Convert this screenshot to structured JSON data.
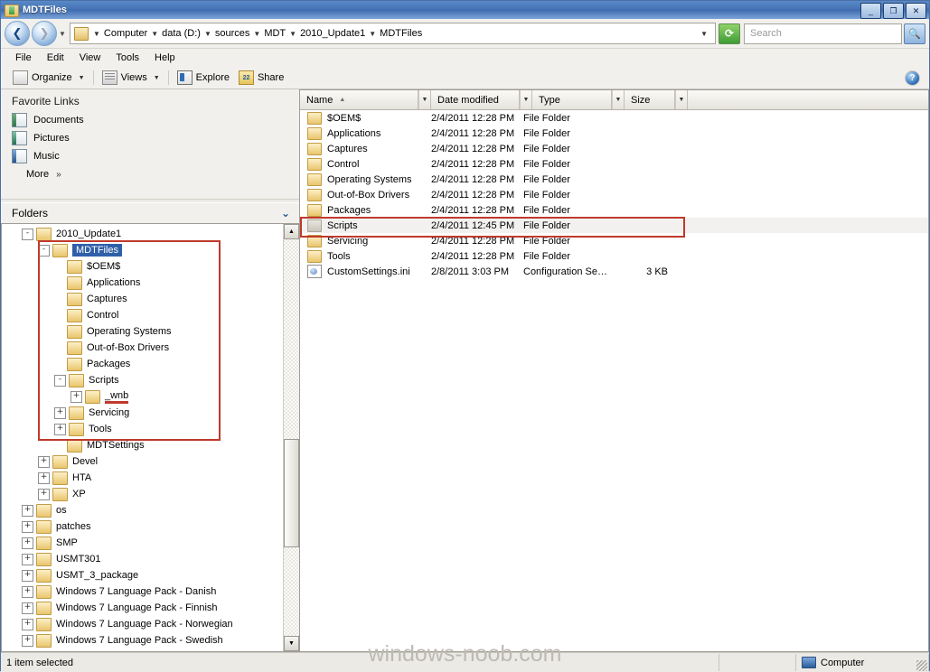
{
  "window": {
    "title": "MDTFiles",
    "icon": "folder-green-icon",
    "controls": {
      "minimize": "_",
      "maximize": "❐",
      "close": "✕"
    }
  },
  "address": {
    "back_icon": "back-arrow-icon",
    "forward_icon": "forward-arrow-icon",
    "history_icon": "chevron-down-icon",
    "folder_icon": "folder-icon",
    "breadcrumbs": [
      "Computer",
      "data (D:)",
      "sources",
      "MDT",
      "2010_Update1",
      "MDTFiles"
    ],
    "refresh_icon": "refresh-icon",
    "search": {
      "placeholder": "Search",
      "value": ""
    },
    "search_button_icon": "magnifier-icon"
  },
  "menu": {
    "items": [
      "File",
      "Edit",
      "View",
      "Tools",
      "Help"
    ]
  },
  "toolbar": {
    "organize": "Organize",
    "views": "Views",
    "explore": "Explore",
    "share": "Share",
    "help_icon": "help-icon"
  },
  "favorites": {
    "title": "Favorite Links",
    "items": [
      {
        "label": "Documents",
        "icon": "documents-icon"
      },
      {
        "label": "Pictures",
        "icon": "pictures-icon"
      },
      {
        "label": "Music",
        "icon": "music-icon"
      }
    ],
    "more": "More",
    "more_icon": "double-chevron-right-icon"
  },
  "folders_panel": {
    "title": "Folders",
    "collapse_icon": "chevron-down-icon",
    "tree": [
      {
        "label": "2010_Update1",
        "indent": 1,
        "expander": "-",
        "icon": "folder-icon",
        "selected": false
      },
      {
        "label": "MDTFiles",
        "indent": 2,
        "expander": "-",
        "icon": "folder-icon",
        "selected": true
      },
      {
        "label": "$OEM$",
        "indent": 3,
        "expander": "",
        "icon": "folder-icon",
        "selected": false
      },
      {
        "label": "Applications",
        "indent": 3,
        "expander": "",
        "icon": "folder-icon",
        "selected": false
      },
      {
        "label": "Captures",
        "indent": 3,
        "expander": "",
        "icon": "folder-icon",
        "selected": false
      },
      {
        "label": "Control",
        "indent": 3,
        "expander": "",
        "icon": "folder-icon",
        "selected": false
      },
      {
        "label": "Operating Systems",
        "indent": 3,
        "expander": "",
        "icon": "folder-icon",
        "selected": false
      },
      {
        "label": "Out-of-Box Drivers",
        "indent": 3,
        "expander": "",
        "icon": "folder-icon",
        "selected": false
      },
      {
        "label": "Packages",
        "indent": 3,
        "expander": "",
        "icon": "folder-icon",
        "selected": false
      },
      {
        "label": "Scripts",
        "indent": 3,
        "expander": "-",
        "icon": "folder-icon",
        "selected": false
      },
      {
        "label": "_wnb",
        "indent": 4,
        "expander": "+",
        "icon": "folder-icon",
        "selected": false,
        "underline": true
      },
      {
        "label": "Servicing",
        "indent": 3,
        "expander": "+",
        "icon": "folder-icon",
        "selected": false
      },
      {
        "label": "Tools",
        "indent": 3,
        "expander": "+",
        "icon": "folder-icon",
        "selected": false
      },
      {
        "label": "MDTSettings",
        "indent": 3,
        "expander": "",
        "icon": "folder-icon",
        "selected": false
      },
      {
        "label": "Devel",
        "indent": 2,
        "expander": "+",
        "icon": "folder-icon",
        "selected": false
      },
      {
        "label": "HTA",
        "indent": 2,
        "expander": "+",
        "icon": "folder-icon",
        "selected": false
      },
      {
        "label": "XP",
        "indent": 2,
        "expander": "+",
        "icon": "folder-icon",
        "selected": false
      },
      {
        "label": "os",
        "indent": 1,
        "expander": "+",
        "icon": "folder-icon",
        "selected": false
      },
      {
        "label": "patches",
        "indent": 1,
        "expander": "+",
        "icon": "folder-icon",
        "selected": false
      },
      {
        "label": "SMP",
        "indent": 1,
        "expander": "+",
        "icon": "folder-icon",
        "selected": false
      },
      {
        "label": "USMT301",
        "indent": 1,
        "expander": "+",
        "icon": "folder-icon",
        "selected": false
      },
      {
        "label": "USMT_3_package",
        "indent": 1,
        "expander": "+",
        "icon": "folder-icon",
        "selected": false
      },
      {
        "label": "Windows 7 Language Pack - Danish",
        "indent": 1,
        "expander": "+",
        "icon": "folder-icon",
        "selected": false
      },
      {
        "label": "Windows 7 Language Pack - Finnish",
        "indent": 1,
        "expander": "+",
        "icon": "folder-icon",
        "selected": false
      },
      {
        "label": "Windows 7 Language Pack - Norwegian",
        "indent": 1,
        "expander": "+",
        "icon": "folder-icon",
        "selected": false
      },
      {
        "label": "Windows 7 Language Pack - Swedish",
        "indent": 1,
        "expander": "+",
        "icon": "folder-icon",
        "selected": false
      }
    ],
    "scroll_up_icon": "scroll-up-arrow-icon",
    "scroll_down_icon": "scroll-down-arrow-icon"
  },
  "filelist": {
    "columns": [
      {
        "label": "Name",
        "sorted": "asc"
      },
      {
        "label": "Date modified",
        "sorted": ""
      },
      {
        "label": "Type",
        "sorted": ""
      },
      {
        "label": "Size",
        "sorted": ""
      }
    ],
    "sort_arrow_icon": "sort-ascending-icon",
    "rows": [
      {
        "name": "$OEM$",
        "date": "2/4/2011 12:28 PM",
        "type": "File Folder",
        "size": "",
        "icon": "folder-icon",
        "selected": false
      },
      {
        "name": "Applications",
        "date": "2/4/2011 12:28 PM",
        "type": "File Folder",
        "size": "",
        "icon": "folder-icon",
        "selected": false
      },
      {
        "name": "Captures",
        "date": "2/4/2011 12:28 PM",
        "type": "File Folder",
        "size": "",
        "icon": "folder-icon",
        "selected": false
      },
      {
        "name": "Control",
        "date": "2/4/2011 12:28 PM",
        "type": "File Folder",
        "size": "",
        "icon": "folder-icon",
        "selected": false
      },
      {
        "name": "Operating Systems",
        "date": "2/4/2011 12:28 PM",
        "type": "File Folder",
        "size": "",
        "icon": "folder-icon",
        "selected": false
      },
      {
        "name": "Out-of-Box Drivers",
        "date": "2/4/2011 12:28 PM",
        "type": "File Folder",
        "size": "",
        "icon": "folder-icon",
        "selected": false
      },
      {
        "name": "Packages",
        "date": "2/4/2011 12:28 PM",
        "type": "File Folder",
        "size": "",
        "icon": "folder-icon",
        "selected": false
      },
      {
        "name": "Scripts",
        "date": "2/4/2011 12:45 PM",
        "type": "File Folder",
        "size": "",
        "icon": "folder-icon",
        "selected": true
      },
      {
        "name": "Servicing",
        "date": "2/4/2011 12:28 PM",
        "type": "File Folder",
        "size": "",
        "icon": "folder-icon",
        "selected": false
      },
      {
        "name": "Tools",
        "date": "2/4/2011 12:28 PM",
        "type": "File Folder",
        "size": "",
        "icon": "folder-icon",
        "selected": false
      },
      {
        "name": "CustomSettings.ini",
        "date": "2/8/2011 3:03 PM",
        "type": "Configuration Se…",
        "size": "3 KB",
        "icon": "ini-file-icon",
        "selected": false
      }
    ]
  },
  "statusbar": {
    "selection": "1 item selected",
    "middle": "",
    "location": "Computer",
    "location_icon": "computer-icon",
    "resize_grip_icon": "resize-grip-icon"
  },
  "watermark": {
    "text": "windows-noob.com"
  },
  "colors": {
    "accent": "#2f5fa8",
    "highlight_box": "#c0392b",
    "titlebar": "#4573b5",
    "chrome": "#f1f0ec"
  }
}
